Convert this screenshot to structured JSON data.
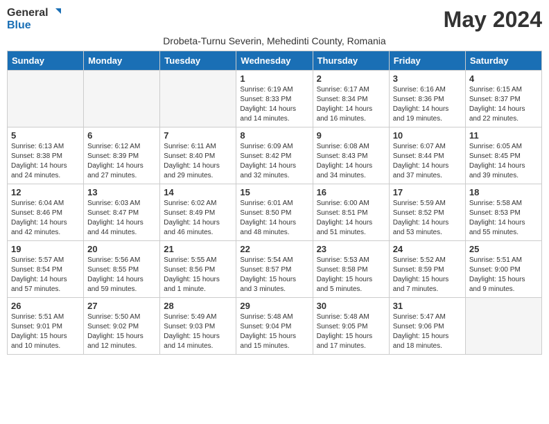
{
  "logo": {
    "text1": "General",
    "text2": "Blue"
  },
  "title": "May 2024",
  "location": "Drobeta-Turnu Severin, Mehedinti County, Romania",
  "days_of_week": [
    "Sunday",
    "Monday",
    "Tuesday",
    "Wednesday",
    "Thursday",
    "Friday",
    "Saturday"
  ],
  "weeks": [
    [
      {
        "day": "",
        "empty": true
      },
      {
        "day": "",
        "empty": true
      },
      {
        "day": "",
        "empty": true
      },
      {
        "day": "1",
        "sunrise": "6:19 AM",
        "sunset": "8:33 PM",
        "daylight": "14 hours and 14 minutes."
      },
      {
        "day": "2",
        "sunrise": "6:17 AM",
        "sunset": "8:34 PM",
        "daylight": "14 hours and 16 minutes."
      },
      {
        "day": "3",
        "sunrise": "6:16 AM",
        "sunset": "8:36 PM",
        "daylight": "14 hours and 19 minutes."
      },
      {
        "day": "4",
        "sunrise": "6:15 AM",
        "sunset": "8:37 PM",
        "daylight": "14 hours and 22 minutes."
      }
    ],
    [
      {
        "day": "5",
        "sunrise": "6:13 AM",
        "sunset": "8:38 PM",
        "daylight": "14 hours and 24 minutes."
      },
      {
        "day": "6",
        "sunrise": "6:12 AM",
        "sunset": "8:39 PM",
        "daylight": "14 hours and 27 minutes."
      },
      {
        "day": "7",
        "sunrise": "6:11 AM",
        "sunset": "8:40 PM",
        "daylight": "14 hours and 29 minutes."
      },
      {
        "day": "8",
        "sunrise": "6:09 AM",
        "sunset": "8:42 PM",
        "daylight": "14 hours and 32 minutes."
      },
      {
        "day": "9",
        "sunrise": "6:08 AM",
        "sunset": "8:43 PM",
        "daylight": "14 hours and 34 minutes."
      },
      {
        "day": "10",
        "sunrise": "6:07 AM",
        "sunset": "8:44 PM",
        "daylight": "14 hours and 37 minutes."
      },
      {
        "day": "11",
        "sunrise": "6:05 AM",
        "sunset": "8:45 PM",
        "daylight": "14 hours and 39 minutes."
      }
    ],
    [
      {
        "day": "12",
        "sunrise": "6:04 AM",
        "sunset": "8:46 PM",
        "daylight": "14 hours and 42 minutes."
      },
      {
        "day": "13",
        "sunrise": "6:03 AM",
        "sunset": "8:47 PM",
        "daylight": "14 hours and 44 minutes."
      },
      {
        "day": "14",
        "sunrise": "6:02 AM",
        "sunset": "8:49 PM",
        "daylight": "14 hours and 46 minutes."
      },
      {
        "day": "15",
        "sunrise": "6:01 AM",
        "sunset": "8:50 PM",
        "daylight": "14 hours and 48 minutes."
      },
      {
        "day": "16",
        "sunrise": "6:00 AM",
        "sunset": "8:51 PM",
        "daylight": "14 hours and 51 minutes."
      },
      {
        "day": "17",
        "sunrise": "5:59 AM",
        "sunset": "8:52 PM",
        "daylight": "14 hours and 53 minutes."
      },
      {
        "day": "18",
        "sunrise": "5:58 AM",
        "sunset": "8:53 PM",
        "daylight": "14 hours and 55 minutes."
      }
    ],
    [
      {
        "day": "19",
        "sunrise": "5:57 AM",
        "sunset": "8:54 PM",
        "daylight": "14 hours and 57 minutes."
      },
      {
        "day": "20",
        "sunrise": "5:56 AM",
        "sunset": "8:55 PM",
        "daylight": "14 hours and 59 minutes."
      },
      {
        "day": "21",
        "sunrise": "5:55 AM",
        "sunset": "8:56 PM",
        "daylight": "15 hours and 1 minute."
      },
      {
        "day": "22",
        "sunrise": "5:54 AM",
        "sunset": "8:57 PM",
        "daylight": "15 hours and 3 minutes."
      },
      {
        "day": "23",
        "sunrise": "5:53 AM",
        "sunset": "8:58 PM",
        "daylight": "15 hours and 5 minutes."
      },
      {
        "day": "24",
        "sunrise": "5:52 AM",
        "sunset": "8:59 PM",
        "daylight": "15 hours and 7 minutes."
      },
      {
        "day": "25",
        "sunrise": "5:51 AM",
        "sunset": "9:00 PM",
        "daylight": "15 hours and 9 minutes."
      }
    ],
    [
      {
        "day": "26",
        "sunrise": "5:51 AM",
        "sunset": "9:01 PM",
        "daylight": "15 hours and 10 minutes."
      },
      {
        "day": "27",
        "sunrise": "5:50 AM",
        "sunset": "9:02 PM",
        "daylight": "15 hours and 12 minutes."
      },
      {
        "day": "28",
        "sunrise": "5:49 AM",
        "sunset": "9:03 PM",
        "daylight": "15 hours and 14 minutes."
      },
      {
        "day": "29",
        "sunrise": "5:48 AM",
        "sunset": "9:04 PM",
        "daylight": "15 hours and 15 minutes."
      },
      {
        "day": "30",
        "sunrise": "5:48 AM",
        "sunset": "9:05 PM",
        "daylight": "15 hours and 17 minutes."
      },
      {
        "day": "31",
        "sunrise": "5:47 AM",
        "sunset": "9:06 PM",
        "daylight": "15 hours and 18 minutes."
      },
      {
        "day": "",
        "empty": true
      }
    ]
  ]
}
